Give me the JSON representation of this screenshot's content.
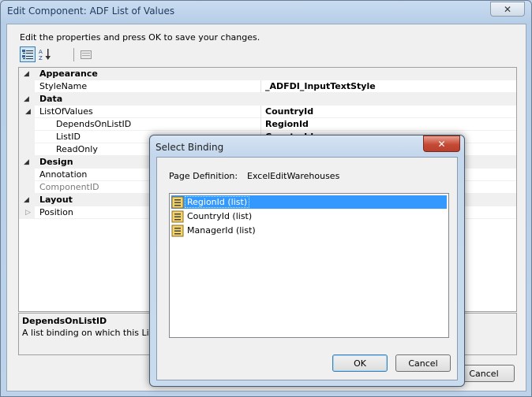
{
  "window": {
    "title": "Edit Component: ADF List of Values",
    "close_glyph": "✕"
  },
  "instructions": "Edit the properties and press OK to save your changes.",
  "toolbar": {
    "categorized_icon": "categorized-view-icon",
    "alphabetical_icon": "alphabetical-sort-icon",
    "property_pages_icon": "property-pages-icon"
  },
  "grid": {
    "rows": [
      {
        "type": "category",
        "name": "Appearance",
        "expanded": true
      },
      {
        "type": "property",
        "name": "StyleName",
        "value": "_ADFDI_InputTextStyle"
      },
      {
        "type": "category",
        "name": "Data",
        "expanded": true
      },
      {
        "type": "property",
        "name": "ListOfValues",
        "value": "CountryId",
        "expanded": true
      },
      {
        "type": "property",
        "name": "DependsOnListID",
        "value": "RegionId"
      },
      {
        "type": "property",
        "name": "ListID",
        "value": "CountryId"
      },
      {
        "type": "property",
        "name": "ReadOnly",
        "value": ""
      },
      {
        "type": "category",
        "name": "Design",
        "expanded": true
      },
      {
        "type": "property",
        "name": "Annotation",
        "value": ""
      },
      {
        "type": "property",
        "name": "ComponentID",
        "value": "",
        "disabled": true
      },
      {
        "type": "category",
        "name": "Layout",
        "expanded": true
      },
      {
        "type": "property",
        "name": "Position",
        "value": "",
        "expanded": false
      }
    ]
  },
  "description": {
    "title": "DependsOnListID",
    "text": "A list binding on which this List of V"
  },
  "main_buttons": {
    "cancel": "Cancel"
  },
  "dialog": {
    "title": "Select Binding",
    "close_glyph": "✕",
    "page_definition_label": "Page Definition:",
    "page_definition_value": "ExcelEditWarehouses",
    "items": [
      {
        "label": "RegionId (list)",
        "selected": true
      },
      {
        "label": "CountryId (list)",
        "selected": false
      },
      {
        "label": "ManagerId (list)",
        "selected": false
      }
    ],
    "ok": "OK",
    "cancel": "Cancel"
  }
}
